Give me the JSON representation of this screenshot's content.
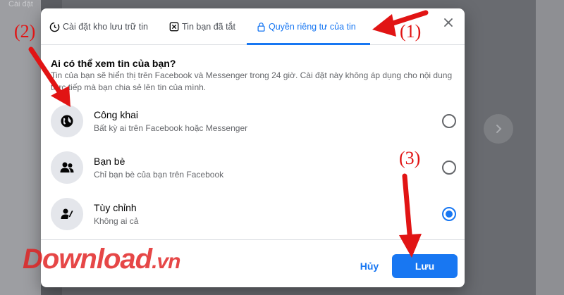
{
  "background": {
    "sidebar_label": "Cài đặt"
  },
  "tabs": [
    {
      "label": "Cài đặt kho lưu trữ tin",
      "icon": "archive-clock-icon",
      "active": false
    },
    {
      "label": "Tin bạn đã tắt",
      "icon": "mute-box-icon",
      "active": false
    },
    {
      "label": "Quyền riêng tư của tin",
      "icon": "lock-icon",
      "active": true
    }
  ],
  "dialog": {
    "question": "Ai có thể xem tin của bạn?",
    "description": "Tin của bạn sẽ hiển thị trên Facebook và Messenger trong 24 giờ. Cài đặt này không áp dụng cho nội dung trực tiếp mà bạn chia sẻ lên tin của mình."
  },
  "options": [
    {
      "title": "Công khai",
      "subtitle": "Bất kỳ ai trên Facebook hoặc Messenger",
      "icon": "globe-icon",
      "selected": false
    },
    {
      "title": "Bạn bè",
      "subtitle": "Chỉ bạn bè của bạn trên Facebook",
      "icon": "friends-icon",
      "selected": false
    },
    {
      "title": "Tùy chỉnh",
      "subtitle": "Không ai cả",
      "icon": "custom-user-icon",
      "selected": true
    }
  ],
  "footer": {
    "cancel_label": "Hủy",
    "save_label": "Lưu"
  },
  "annotations": {
    "step1": "(1)",
    "step2": "(2)",
    "step3": "(3)"
  },
  "watermark": {
    "brand": "Download",
    "suffix": ".vn"
  },
  "colors": {
    "accent": "#1877f2",
    "annotation": "#e11414"
  }
}
